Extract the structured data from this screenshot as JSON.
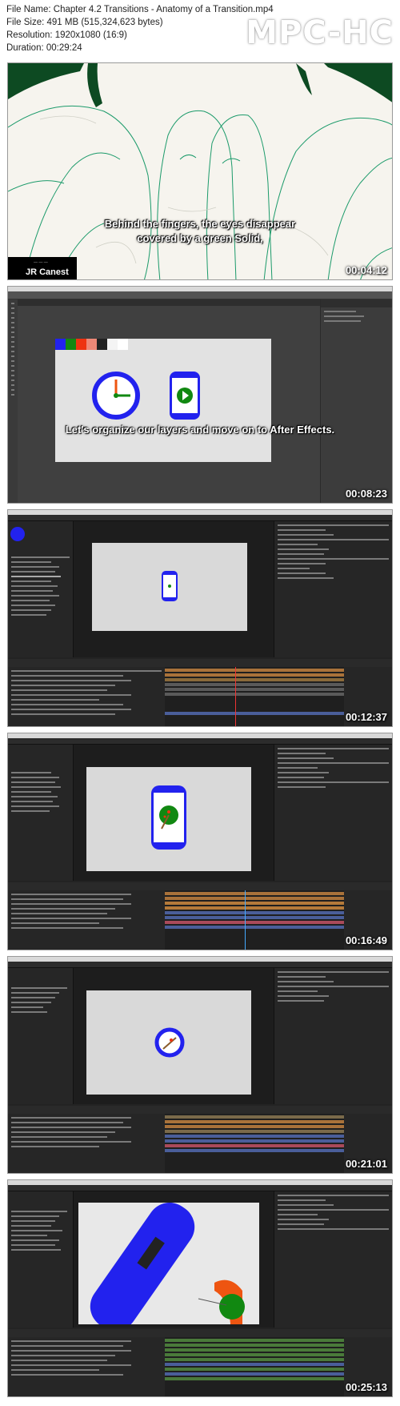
{
  "file_info": {
    "file_name": "File Name: Chapter 4.2 Transitions - Anatomy of a Transition.mp4",
    "file_size": "File Size: 491 MB (515,324,623 bytes)",
    "resolution": "Resolution: 1920x1080 (16:9)",
    "duration": "Duration: 00:29:24"
  },
  "logo": "MPC-HC",
  "frames": [
    {
      "timestamp": "00:04:12",
      "subtitle_line1": "Behind the fingers, the eyes disappear",
      "subtitle_line2": "covered by a green Solid,",
      "author": "JR Canest"
    },
    {
      "timestamp": "00:08:23",
      "subtitle_line1": "Let's organize our layers and move on to After Effects."
    },
    {
      "timestamp": "00:12:37"
    },
    {
      "timestamp": "00:16:49"
    },
    {
      "timestamp": "00:21:01"
    },
    {
      "timestamp": "00:25:13"
    }
  ],
  "colors": {
    "accent_blue": "#2222ee",
    "green": "#118811",
    "orange": "#ee5511",
    "dark_green": "#0d4a22",
    "timeline_orange": "#a9723a",
    "timeline_blue": "#4a5e9a",
    "timeline_green": "#4a7a3a"
  }
}
